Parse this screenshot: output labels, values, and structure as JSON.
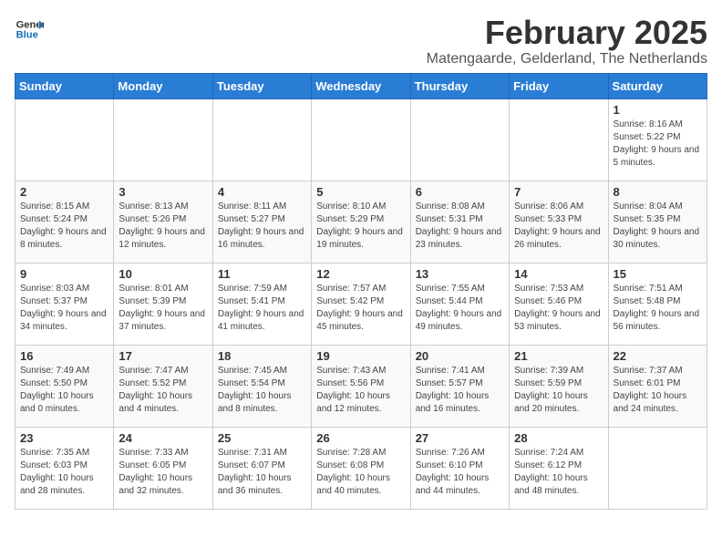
{
  "logo": {
    "general": "General",
    "blue": "Blue"
  },
  "header": {
    "month": "February 2025",
    "location": "Matengaarde, Gelderland, The Netherlands"
  },
  "weekdays": [
    "Sunday",
    "Monday",
    "Tuesday",
    "Wednesday",
    "Thursday",
    "Friday",
    "Saturday"
  ],
  "weeks": [
    [
      {
        "day": "",
        "info": ""
      },
      {
        "day": "",
        "info": ""
      },
      {
        "day": "",
        "info": ""
      },
      {
        "day": "",
        "info": ""
      },
      {
        "day": "",
        "info": ""
      },
      {
        "day": "",
        "info": ""
      },
      {
        "day": "1",
        "info": "Sunrise: 8:16 AM\nSunset: 5:22 PM\nDaylight: 9 hours and 5 minutes."
      }
    ],
    [
      {
        "day": "2",
        "info": "Sunrise: 8:15 AM\nSunset: 5:24 PM\nDaylight: 9 hours and 8 minutes."
      },
      {
        "day": "3",
        "info": "Sunrise: 8:13 AM\nSunset: 5:26 PM\nDaylight: 9 hours and 12 minutes."
      },
      {
        "day": "4",
        "info": "Sunrise: 8:11 AM\nSunset: 5:27 PM\nDaylight: 9 hours and 16 minutes."
      },
      {
        "day": "5",
        "info": "Sunrise: 8:10 AM\nSunset: 5:29 PM\nDaylight: 9 hours and 19 minutes."
      },
      {
        "day": "6",
        "info": "Sunrise: 8:08 AM\nSunset: 5:31 PM\nDaylight: 9 hours and 23 minutes."
      },
      {
        "day": "7",
        "info": "Sunrise: 8:06 AM\nSunset: 5:33 PM\nDaylight: 9 hours and 26 minutes."
      },
      {
        "day": "8",
        "info": "Sunrise: 8:04 AM\nSunset: 5:35 PM\nDaylight: 9 hours and 30 minutes."
      }
    ],
    [
      {
        "day": "9",
        "info": "Sunrise: 8:03 AM\nSunset: 5:37 PM\nDaylight: 9 hours and 34 minutes."
      },
      {
        "day": "10",
        "info": "Sunrise: 8:01 AM\nSunset: 5:39 PM\nDaylight: 9 hours and 37 minutes."
      },
      {
        "day": "11",
        "info": "Sunrise: 7:59 AM\nSunset: 5:41 PM\nDaylight: 9 hours and 41 minutes."
      },
      {
        "day": "12",
        "info": "Sunrise: 7:57 AM\nSunset: 5:42 PM\nDaylight: 9 hours and 45 minutes."
      },
      {
        "day": "13",
        "info": "Sunrise: 7:55 AM\nSunset: 5:44 PM\nDaylight: 9 hours and 49 minutes."
      },
      {
        "day": "14",
        "info": "Sunrise: 7:53 AM\nSunset: 5:46 PM\nDaylight: 9 hours and 53 minutes."
      },
      {
        "day": "15",
        "info": "Sunrise: 7:51 AM\nSunset: 5:48 PM\nDaylight: 9 hours and 56 minutes."
      }
    ],
    [
      {
        "day": "16",
        "info": "Sunrise: 7:49 AM\nSunset: 5:50 PM\nDaylight: 10 hours and 0 minutes."
      },
      {
        "day": "17",
        "info": "Sunrise: 7:47 AM\nSunset: 5:52 PM\nDaylight: 10 hours and 4 minutes."
      },
      {
        "day": "18",
        "info": "Sunrise: 7:45 AM\nSunset: 5:54 PM\nDaylight: 10 hours and 8 minutes."
      },
      {
        "day": "19",
        "info": "Sunrise: 7:43 AM\nSunset: 5:56 PM\nDaylight: 10 hours and 12 minutes."
      },
      {
        "day": "20",
        "info": "Sunrise: 7:41 AM\nSunset: 5:57 PM\nDaylight: 10 hours and 16 minutes."
      },
      {
        "day": "21",
        "info": "Sunrise: 7:39 AM\nSunset: 5:59 PM\nDaylight: 10 hours and 20 minutes."
      },
      {
        "day": "22",
        "info": "Sunrise: 7:37 AM\nSunset: 6:01 PM\nDaylight: 10 hours and 24 minutes."
      }
    ],
    [
      {
        "day": "23",
        "info": "Sunrise: 7:35 AM\nSunset: 6:03 PM\nDaylight: 10 hours and 28 minutes."
      },
      {
        "day": "24",
        "info": "Sunrise: 7:33 AM\nSunset: 6:05 PM\nDaylight: 10 hours and 32 minutes."
      },
      {
        "day": "25",
        "info": "Sunrise: 7:31 AM\nSunset: 6:07 PM\nDaylight: 10 hours and 36 minutes."
      },
      {
        "day": "26",
        "info": "Sunrise: 7:28 AM\nSunset: 6:08 PM\nDaylight: 10 hours and 40 minutes."
      },
      {
        "day": "27",
        "info": "Sunrise: 7:26 AM\nSunset: 6:10 PM\nDaylight: 10 hours and 44 minutes."
      },
      {
        "day": "28",
        "info": "Sunrise: 7:24 AM\nSunset: 6:12 PM\nDaylight: 10 hours and 48 minutes."
      },
      {
        "day": "",
        "info": ""
      }
    ]
  ]
}
